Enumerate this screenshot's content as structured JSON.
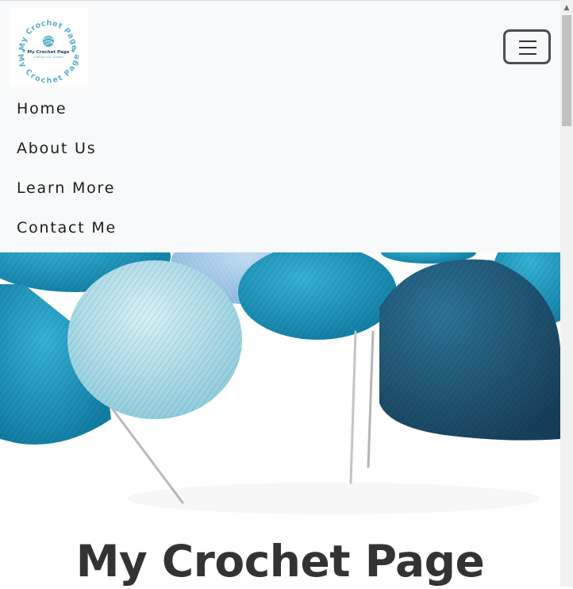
{
  "logo": {
    "arc_top": "My Crochet Page",
    "arc_bottom": "My Crochet Page",
    "center_title": "My Crochet Page",
    "center_tagline": "Crafting cozy dreams"
  },
  "navbar": {
    "toggler_icon": "hamburger-icon",
    "items": [
      {
        "label": "Home"
      },
      {
        "label": "About Us"
      },
      {
        "label": "Learn More"
      },
      {
        "label": "Contact Me"
      }
    ]
  },
  "hero": {
    "image": "yarn-balls-knitting-needles",
    "title": "My Crochet Page"
  },
  "colors": {
    "navbar_bg": "#f8f9fa",
    "text": "#1c1c1c",
    "title": "#333333",
    "logo_teal": "#5aaec8",
    "yarn_teal": "#1a93b8",
    "yarn_light": "#a9d9e6",
    "yarn_dark": "#21597a"
  }
}
